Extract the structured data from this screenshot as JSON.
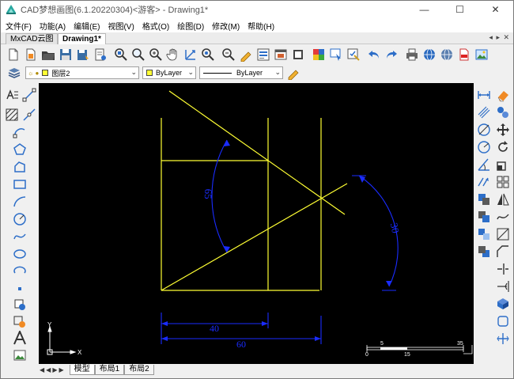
{
  "window": {
    "title": "CAD梦想画图(6.1.20220304)<游客> - Drawing1*",
    "minimize": "—",
    "maximize": "☐",
    "close": "✕"
  },
  "menu": [
    "文件(F)",
    "功能(A)",
    "编辑(E)",
    "视图(V)",
    "格式(O)",
    "绘图(D)",
    "修改(M)",
    "帮助(H)"
  ],
  "doc_tabs": [
    {
      "label": "MxCAD云图",
      "active": false
    },
    {
      "label": "Drawing1*",
      "active": true
    }
  ],
  "tab_controls": "◂ ▸ ✕",
  "layer_bar": {
    "layer_name": "图层2",
    "color_value": "ByLayer",
    "linetype_value": "ByLayer"
  },
  "drawing": {
    "dim_angle_left": "65",
    "dim_angle_right": "30",
    "dim_linear_inner": "40",
    "dim_linear_outer": "60",
    "scale_top_labels": [
      "5",
      "35"
    ],
    "scale_bottom_labels": [
      "0",
      "15"
    ],
    "ucs_x": "X",
    "ucs_y": "Y",
    "colors": {
      "background": "#000000",
      "geometry": "#ffff33",
      "dimension": "#1a2cff",
      "ucs": "#ffffff"
    }
  },
  "layout_tabs": [
    {
      "label": "模型",
      "active": true
    },
    {
      "label": "布局1",
      "active": false
    },
    {
      "label": "布局2",
      "active": false
    }
  ]
}
